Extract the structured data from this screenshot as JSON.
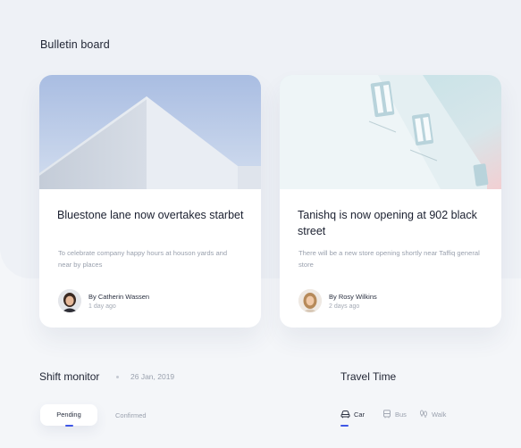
{
  "bulletin": {
    "title": "Bulletin board",
    "cards": [
      {
        "image": "white-building-sky-photo",
        "title": "Bluestone lane now overtakes starbet",
        "description": "To celebrate company happy hours at houson yards and near by places",
        "author": "By Catherin Wassen",
        "time": "1 day ago"
      },
      {
        "image": "building-windows-photo",
        "title": "Tanishq is now opening at 902 black street",
        "description": "There will be a new store opening shortly near Taffiq general store",
        "author": "By Rosy Wilkins",
        "time": "2 days ago"
      }
    ]
  },
  "shift": {
    "title": "Shift monitor",
    "date": "26 Jan, 2019",
    "tabs": [
      {
        "label": "Pending",
        "active": true
      },
      {
        "label": "Confirmed",
        "active": false
      }
    ]
  },
  "travel": {
    "title": "Travel Time",
    "modes": [
      {
        "label": "Car",
        "icon": "car-icon",
        "active": true
      },
      {
        "label": "Bus",
        "icon": "bus-icon",
        "active": false
      },
      {
        "label": "Walk",
        "icon": "footprints-icon",
        "active": false
      }
    ]
  },
  "colors": {
    "accent": "#3e57e6",
    "background": "#f4f6f9",
    "panel": "#eef1f6",
    "card": "#ffffff",
    "muted_text": "#9aa1ae"
  }
}
